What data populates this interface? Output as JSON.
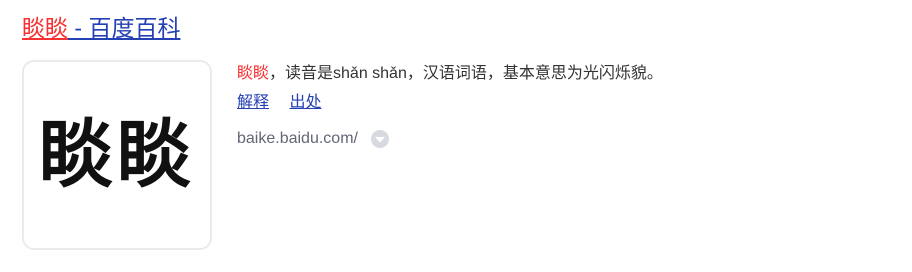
{
  "result": {
    "title_highlight": "睒睒",
    "title_rest": " - 百度百科",
    "thumbnail_text": "睒睒",
    "abstract_highlight": "睒睒",
    "abstract_rest": "，读音是shǎn shǎn，汉语词语，基本意思为光闪烁貌。",
    "links": [
      {
        "label": "解释"
      },
      {
        "label": "出处"
      }
    ],
    "source_url": "baike.baidu.com/",
    "source_menu_icon": "chevron-down-circle-icon"
  },
  "colors": {
    "highlight": "#f73131",
    "link": "#2440b3",
    "source": "#626675"
  }
}
